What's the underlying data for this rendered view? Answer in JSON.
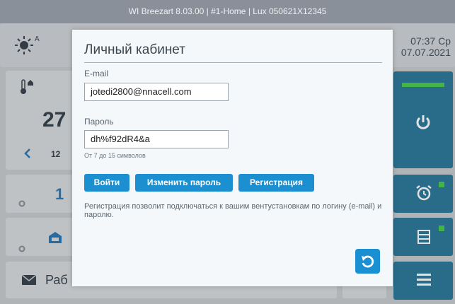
{
  "window": {
    "title": "WI Breezart 8.03.00 | #1-Home | Lux 050621X12345"
  },
  "clock": {
    "time": "07:37 Ср",
    "date": "07.07.2021"
  },
  "background": {
    "temp": "27",
    "temp_sub": "12",
    "speed": "1",
    "mode_label": "Раб"
  },
  "modal": {
    "title": "Личный кабинет",
    "email_label": "E-mail",
    "email_value": "jotedi2800@nnacell.com",
    "password_label": "Пароль",
    "password_value": "dh%f92dR4&a",
    "password_hint": "От 7 до 15 символов",
    "buttons": {
      "login": "Войти",
      "change_password": "Изменить пароль",
      "register": "Регистрация"
    },
    "note": "Регистрация позволит подключаться к вашим вентустановкам по логину (e-mail) и паролю."
  },
  "colors": {
    "accent": "#1c8fd0",
    "panel_dark": "#1f6f93",
    "indicator": "#3ec83e"
  },
  "icons": [
    "sun-icon",
    "thermometer-home-icon",
    "chevron-left-icon",
    "gear-icon",
    "car-icon",
    "mail-icon",
    "power-icon",
    "alarm-clock-icon",
    "filter-icon",
    "menu-icon",
    "refresh-icon"
  ]
}
